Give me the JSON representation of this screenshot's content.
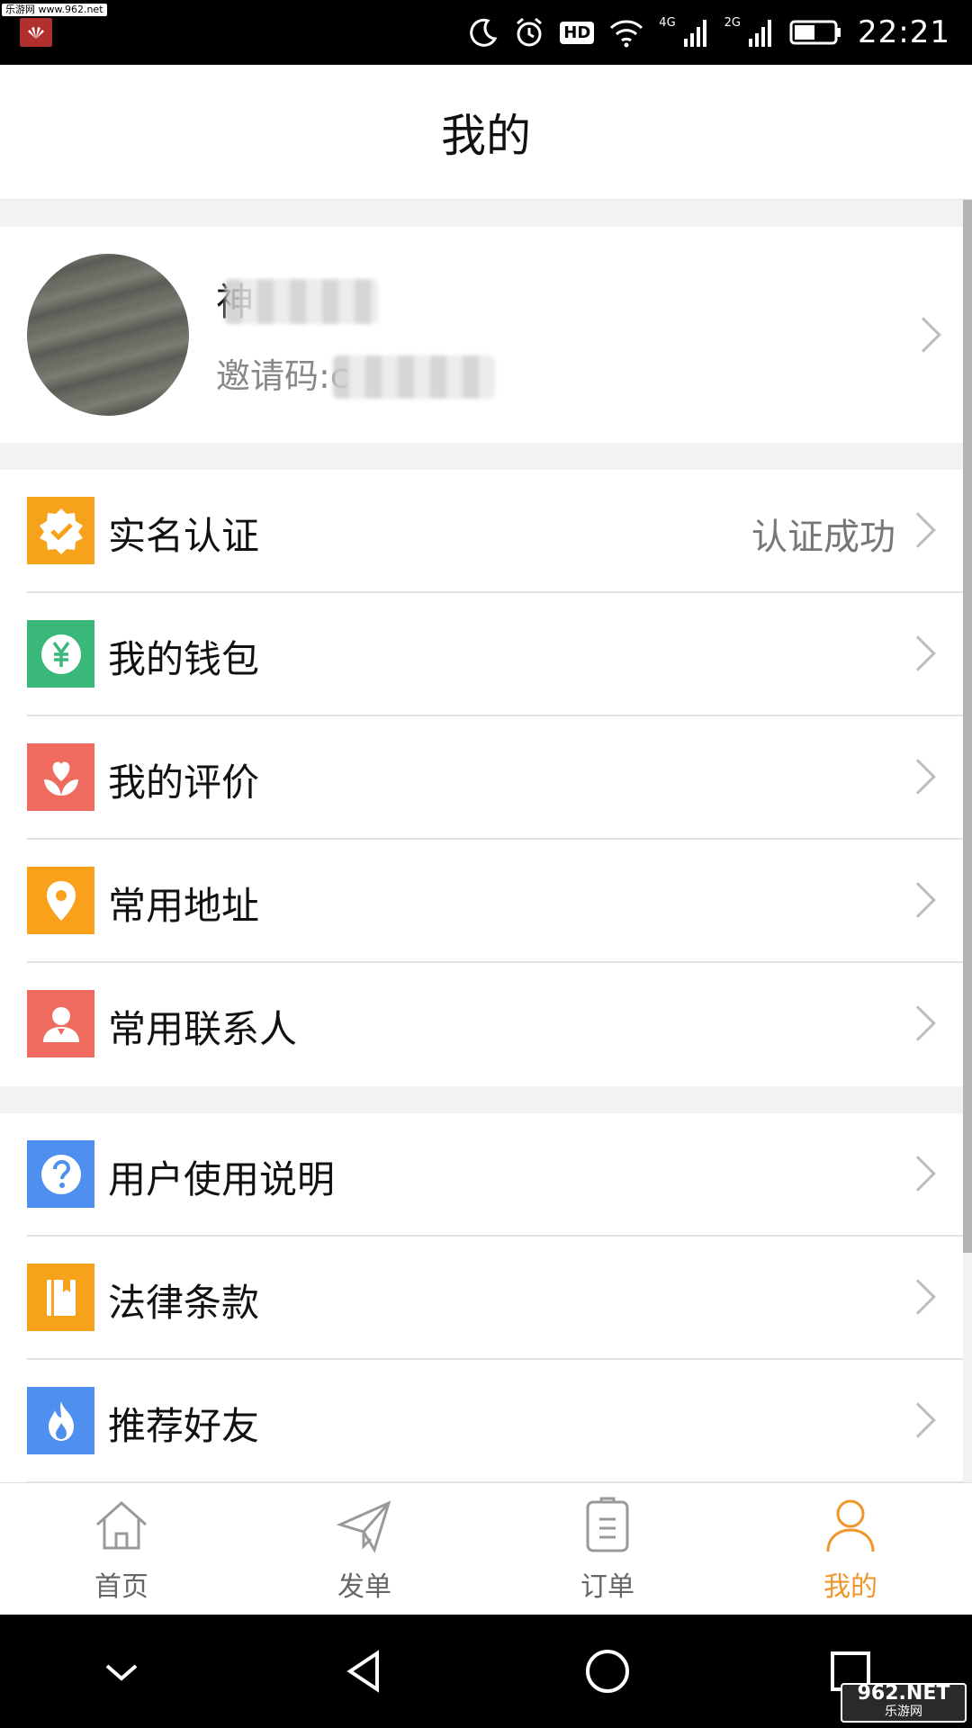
{
  "status_bar": {
    "watermark": "乐游网 www.962.net",
    "net_4g": "4G",
    "net_2g": "2G",
    "hd": "HD",
    "time": "22:21"
  },
  "header": {
    "title": "我的"
  },
  "profile": {
    "name": "神",
    "invite_prefix": "邀请码:",
    "invite_value": "c"
  },
  "groups": [
    {
      "items": [
        {
          "label": "实名认证",
          "value": "认证成功",
          "icon": "verified-badge-icon",
          "color": "#f7a21b"
        },
        {
          "label": "我的钱包",
          "value": "",
          "icon": "wallet-yen-icon",
          "color": "#39b87a"
        },
        {
          "label": "我的评价",
          "value": "",
          "icon": "flower-heart-icon",
          "color": "#ef6b5f"
        },
        {
          "label": "常用地址",
          "value": "",
          "icon": "location-pin-icon",
          "color": "#f9a11b"
        },
        {
          "label": "常用联系人",
          "value": "",
          "icon": "contact-person-icon",
          "color": "#ef6b5f"
        }
      ]
    },
    {
      "items": [
        {
          "label": "用户使用说明",
          "value": "",
          "icon": "help-question-icon",
          "color": "#4f8ff0"
        },
        {
          "label": "法律条款",
          "value": "",
          "icon": "law-book-icon",
          "color": "#f7a21b"
        },
        {
          "label": "推荐好友",
          "value": "",
          "icon": "flame-icon",
          "color": "#4f8ff0"
        }
      ]
    }
  ],
  "bottom_nav": [
    {
      "label": "首页",
      "icon": "home-icon",
      "active": false
    },
    {
      "label": "发单",
      "icon": "paper-plane-icon",
      "active": false
    },
    {
      "label": "订单",
      "icon": "order-list-icon",
      "active": false
    },
    {
      "label": "我的",
      "icon": "user-icon",
      "active": true
    }
  ],
  "colors": {
    "accent": "#f0962d",
    "inactive_nav": "#999999"
  },
  "corner_logo": {
    "main": "962.NET",
    "sub": "乐游网"
  }
}
